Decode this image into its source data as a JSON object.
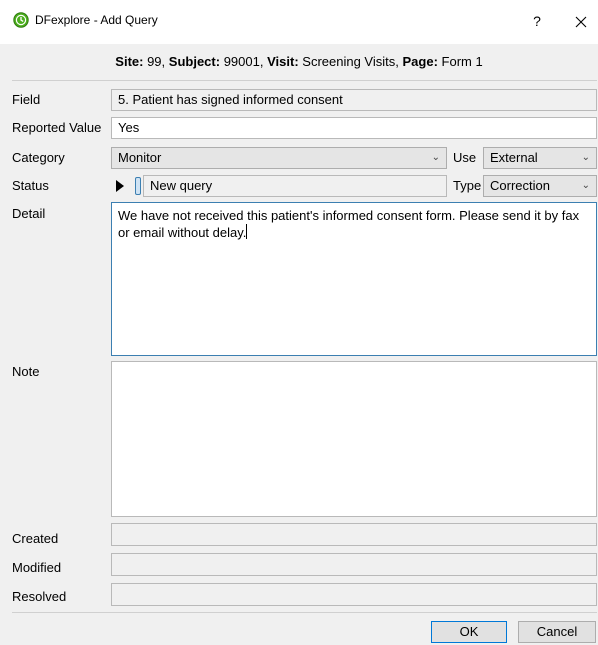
{
  "window": {
    "title": "DFexplore - Add Query",
    "help_glyph": "?",
    "close_glyph": "✕"
  },
  "header": {
    "site_label": "Site:",
    "site_value": "99",
    "subject_label": "Subject:",
    "subject_value": "99001",
    "visit_label": "Visit:",
    "visit_value": "Screening Visits",
    "page_label": "Page:",
    "page_value": "Form 1"
  },
  "form": {
    "field_label": "Field",
    "field_value": "5. Patient has signed informed consent",
    "reported_label": "Reported Value",
    "reported_value": "Yes",
    "category_label": "Category",
    "category_value": "Monitor",
    "use_label": "Use",
    "use_value": "External",
    "status_label": "Status",
    "status_value": "New query",
    "type_label": "Type",
    "type_value": "Correction",
    "detail_label": "Detail",
    "detail_value": "We have not received this patient's informed consent form. Please send it by fax or email without delay.",
    "note_label": "Note",
    "note_value": "",
    "created_label": "Created",
    "created_value": "",
    "modified_label": "Modified",
    "modified_value": "",
    "resolved_label": "Resolved",
    "resolved_value": ""
  },
  "buttons": {
    "ok_label": "OK",
    "cancel_label": "Cancel"
  },
  "icons": {
    "app": "clock-icon",
    "dropdown": "chevron-down-icon",
    "status_play": "play-icon",
    "status_indicator": "status-indicator-icon"
  },
  "colors": {
    "accent": "#0078d7",
    "focus_border": "#3c7fb1",
    "icon_green": "#4caf1e"
  }
}
